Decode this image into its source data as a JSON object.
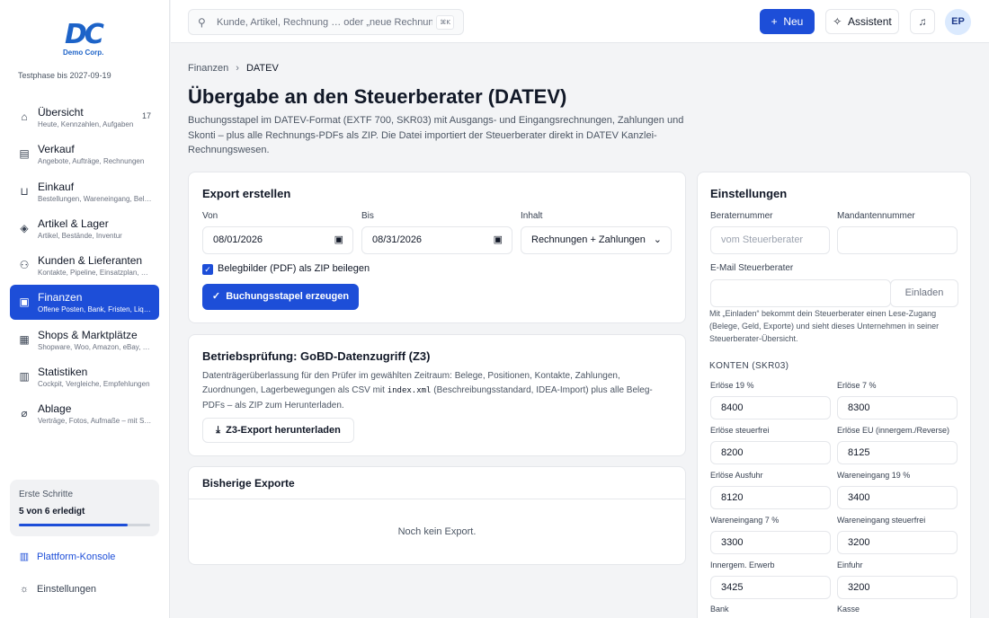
{
  "brand": {
    "logo_text": "DC",
    "logo_sub": "Demo Corp.",
    "trial": "Testphase bis 2027-09-19"
  },
  "colors": {
    "accent": "#1d4ed8",
    "background": "#f3f4f6"
  },
  "sidebar": {
    "items": [
      {
        "label": "Übersicht",
        "sub": "Heute, Kennzahlen, Aufgaben",
        "badge": "17",
        "icon": "home-icon"
      },
      {
        "label": "Verkauf",
        "sub": "Angebote, Aufträge, Rechnungen",
        "icon": "archive-icon"
      },
      {
        "label": "Einkauf",
        "sub": "Bestellungen, Wareneingang, Belege",
        "icon": "cart-icon"
      },
      {
        "label": "Artikel & Lager",
        "sub": "Artikel, Bestände, Inventur",
        "icon": "box-icon"
      },
      {
        "label": "Kunden & Lieferanten",
        "sub": "Kontakte, Pipeline, Einsatzplan, Lieferanten",
        "icon": "users-icon"
      },
      {
        "label": "Finanzen",
        "sub": "Offene Posten, Bank, Fristen, Liquidität",
        "icon": "finance-icon"
      },
      {
        "label": "Shops & Marktplätze",
        "sub": "Shopware, Woo, Amazon, eBay, Otto",
        "icon": "shop-icon"
      },
      {
        "label": "Statistiken",
        "sub": "Cockpit, Vergleiche, Empfehlungen",
        "icon": "chart-icon"
      },
      {
        "label": "Ablage",
        "sub": "Verträge, Fotos, Aufmaße – mit Suche",
        "icon": "paperclip-icon"
      }
    ],
    "steps": {
      "title": "Erste Schritte",
      "count": "5 von 6 erledigt",
      "progress": 0.83
    },
    "platform": "Plattform-Konsole",
    "settings": "Einstellungen"
  },
  "topbar": {
    "search_placeholder": "Kunde, Artikel, Rechnung … oder „neue Rechnung“",
    "search_kbd": "⌘K",
    "new_label": "Neu",
    "assistant_label": "Assistent",
    "avatar": "EP"
  },
  "breadcrumb": {
    "parent": "Finanzen",
    "current": "DATEV"
  },
  "page": {
    "title": "Übergabe an den Steuerberater (DATEV)",
    "description": "Buchungsstapel im DATEV-Format (EXTF 700, SKR03) mit Ausgangs- und Eingangsrechnungen, Zahlungen und Skonti – plus alle Rechnungs-PDFs als ZIP. Die Datei importiert der Steuerberater direkt in DATEV Kanzlei-Rechnungswesen."
  },
  "export": {
    "title": "Export erstellen",
    "from_label": "Von",
    "from_value": "08/01/2026",
    "to_label": "Bis",
    "to_value": "08/31/2026",
    "content_label": "Inhalt",
    "content_value": "Rechnungen + Zahlungen",
    "zip_label": "Belegbilder (PDF) als ZIP beilegen",
    "button": "Buchungsstapel erzeugen"
  },
  "gobd": {
    "title": "Betriebsprüfung: GoBD-Datenzugriff (Z3)",
    "desc_a": "Datenträgerüberlassung für den Prüfer im gewählten Zeitraum: Belege, Positionen, Kontakte, Zahlungen, Zuordnungen, Lagerbewegungen als CSV mit",
    "desc_code": "index.xml",
    "desc_b": "(Beschreibungsstandard, IDEA-Import) plus alle Beleg-PDFs – als ZIP zum Herunterladen.",
    "button": "Z3-Export herunterladen"
  },
  "history": {
    "title": "Bisherige Exporte",
    "empty": "Noch kein Export."
  },
  "settings": {
    "title": "Einstellungen",
    "advisor_label": "Beraternummer",
    "advisor_placeholder": "vom Steuerberater",
    "client_label": "Mandantennummer",
    "email_label": "E-Mail Steuerberater",
    "invite_label": "Einladen",
    "invite_desc": "Mit „Einladen“ bekommt dein Steuerberater einen Lese-Zugang (Belege, Geld, Exporte) und sieht dieses Unternehmen in seiner Steuerberater-Übersicht.",
    "accounts_heading": "KONTEN (SKR03)",
    "accounts": [
      {
        "label": "Erlöse 19 %",
        "value": "8400"
      },
      {
        "label": "Erlöse 7 %",
        "value": "8300"
      },
      {
        "label": "Erlöse steuerfrei",
        "value": "8200"
      },
      {
        "label": "Erlöse EU (innergem./Reverse)",
        "value": "8125"
      },
      {
        "label": "Erlöse Ausfuhr",
        "value": "8120"
      },
      {
        "label": "Wareneingang 19 %",
        "value": "3400"
      },
      {
        "label": "Wareneingang 7 %",
        "value": "3300"
      },
      {
        "label": "Wareneingang steuerfrei",
        "value": "3200"
      },
      {
        "label": "Innergem. Erwerb",
        "value": "3425"
      },
      {
        "label": "Einfuhr",
        "value": "3200"
      }
    ],
    "bank_label": "Bank",
    "cash_label": "Kasse"
  }
}
